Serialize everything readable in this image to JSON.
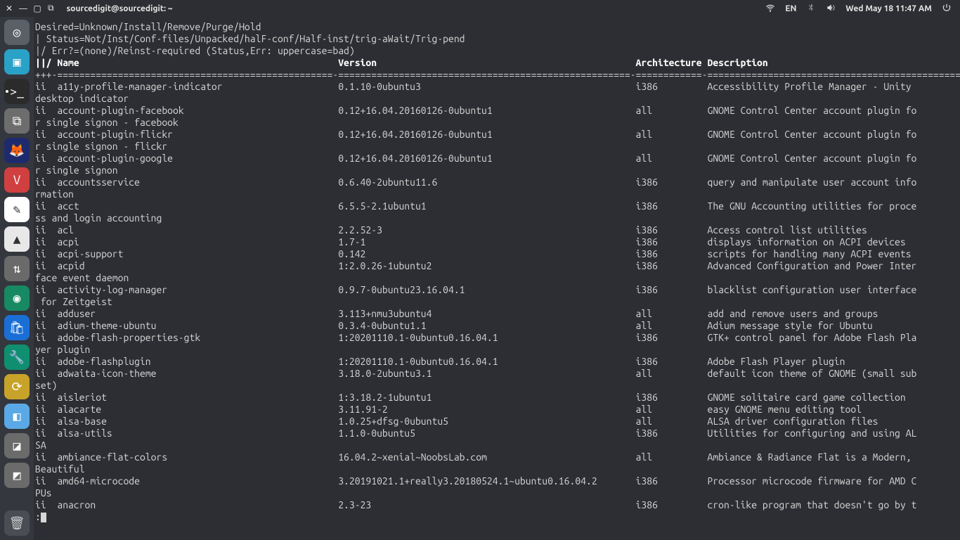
{
  "topbar": {
    "title": "sourcedigit@sourcedigit: ~",
    "lang": "EN",
    "clock": "Wed May 18 11:47 AM"
  },
  "dock": {
    "items": [
      {
        "name": "ubuntu-logo-icon",
        "bg": "#5b5f68",
        "glyph": "◎"
      },
      {
        "name": "files-icon",
        "bg": "#2aa1c7",
        "glyph": "▣"
      },
      {
        "name": "terminal-icon",
        "bg": "#2b2b2b",
        "glyph": ">_"
      },
      {
        "name": "archive-icon",
        "bg": "#6d6d6d",
        "glyph": "⧉"
      },
      {
        "name": "firefox-icon",
        "bg": "#1e2a6e",
        "glyph": "🦊"
      },
      {
        "name": "vivaldi-icon",
        "bg": "#d04040",
        "glyph": "V"
      },
      {
        "name": "text-editor-icon",
        "bg": "#ffffff",
        "glyph": "✎"
      },
      {
        "name": "vlc-icon",
        "bg": "#e8e8e8",
        "glyph": "▲"
      },
      {
        "name": "transmission-icon",
        "bg": "#6a6a6a",
        "glyph": "⇅"
      },
      {
        "name": "screenshot-icon",
        "bg": "#178a63",
        "glyph": "◉"
      },
      {
        "name": "software-icon",
        "bg": "#1a6fd6",
        "glyph": "🛍"
      },
      {
        "name": "settings-icon",
        "bg": "#0f8f6f",
        "glyph": "🔧"
      },
      {
        "name": "sync-icon",
        "bg": "#c8a32a",
        "glyph": "⟳"
      },
      {
        "name": "app-icon-1",
        "bg": "#5aa9e6",
        "glyph": "◧"
      },
      {
        "name": "app-icon-2",
        "bg": "#6b6b6b",
        "glyph": "◪"
      },
      {
        "name": "app-icon-3",
        "bg": "#6b6b6b",
        "glyph": "◩"
      }
    ],
    "trash": {
      "name": "trash-icon",
      "bg": "#4a4d54",
      "glyph": "🗑"
    }
  },
  "term": {
    "header": [
      "Desired=Unknown/Install/Remove/Purge/Hold",
      "| Status=Not/Inst/Conf-files/Unpacked/halF-conf/Half-inst/trig-aWait/Trig-pend",
      "|/ Err?=(none)/Reinst-required (Status,Err: uppercase=bad)"
    ],
    "colhdr": {
      "name": "||/ Name",
      "version": "Version",
      "arch": "Architecture",
      "desc": "Description"
    },
    "sep": "+++-==================================================-=====================================================-============-===============================================",
    "rows": [
      {
        "st": "ii",
        "name": "a11y-profile-manager-indicator",
        "ver": "0.1.10-0ubuntu3",
        "arch": "i386",
        "desc": "Accessibility Profile Manager - Unity",
        "wrap": "desktop indicator"
      },
      {
        "st": "ii",
        "name": "account-plugin-facebook",
        "ver": "0.12+16.04.20160126-0ubuntu1",
        "arch": "all",
        "desc": "GNOME Control Center account plugin fo",
        "wrap": "r single signon - facebook"
      },
      {
        "st": "ii",
        "name": "account-plugin-flickr",
        "ver": "0.12+16.04.20160126-0ubuntu1",
        "arch": "all",
        "desc": "GNOME Control Center account plugin fo",
        "wrap": "r single signon - flickr"
      },
      {
        "st": "ii",
        "name": "account-plugin-google",
        "ver": "0.12+16.04.20160126-0ubuntu1",
        "arch": "all",
        "desc": "GNOME Control Center account plugin fo",
        "wrap": "r single signon"
      },
      {
        "st": "ii",
        "name": "accountsservice",
        "ver": "0.6.40-2ubuntu11.6",
        "arch": "i386",
        "desc": "query and manipulate user account info",
        "wrap": "rmation"
      },
      {
        "st": "ii",
        "name": "acct",
        "ver": "6.5.5-2.1ubuntu1",
        "arch": "i386",
        "desc": "The GNU Accounting utilities for proce",
        "wrap": "ss and login accounting"
      },
      {
        "st": "ii",
        "name": "acl",
        "ver": "2.2.52-3",
        "arch": "i386",
        "desc": "Access control list utilities"
      },
      {
        "st": "ii",
        "name": "acpi",
        "ver": "1.7-1",
        "arch": "i386",
        "desc": "displays information on ACPI devices"
      },
      {
        "st": "ii",
        "name": "acpi-support",
        "ver": "0.142",
        "arch": "i386",
        "desc": "scripts for handling many ACPI events"
      },
      {
        "st": "ii",
        "name": "acpid",
        "ver": "1:2.0.26-1ubuntu2",
        "arch": "i386",
        "desc": "Advanced Configuration and Power Inter",
        "wrap": "face event daemon"
      },
      {
        "st": "ii",
        "name": "activity-log-manager",
        "ver": "0.9.7-0ubuntu23.16.04.1",
        "arch": "i386",
        "desc": "blacklist configuration user interface",
        "wrap": " for Zeitgeist"
      },
      {
        "st": "ii",
        "name": "adduser",
        "ver": "3.113+nmu3ubuntu4",
        "arch": "all",
        "desc": "add and remove users and groups"
      },
      {
        "st": "ii",
        "name": "adium-theme-ubuntu",
        "ver": "0.3.4-0ubuntu1.1",
        "arch": "all",
        "desc": "Adium message style for Ubuntu"
      },
      {
        "st": "ii",
        "name": "adobe-flash-properties-gtk",
        "ver": "1:20201110.1-0ubuntu0.16.04.1",
        "arch": "i386",
        "desc": "GTK+ control panel for Adobe Flash Pla",
        "wrap": "yer plugin"
      },
      {
        "st": "ii",
        "name": "adobe-flashplugin",
        "ver": "1:20201110.1-0ubuntu0.16.04.1",
        "arch": "i386",
        "desc": "Adobe Flash Player plugin"
      },
      {
        "st": "ii",
        "name": "adwaita-icon-theme",
        "ver": "3.18.0-2ubuntu3.1",
        "arch": "all",
        "desc": "default icon theme of GNOME (small sub",
        "wrap": "set)"
      },
      {
        "st": "ii",
        "name": "aisleriot",
        "ver": "1:3.18.2-1ubuntu1",
        "arch": "i386",
        "desc": "GNOME solitaire card game collection"
      },
      {
        "st": "ii",
        "name": "alacarte",
        "ver": "3.11.91-2",
        "arch": "all",
        "desc": "easy GNOME menu editing tool"
      },
      {
        "st": "ii",
        "name": "alsa-base",
        "ver": "1.0.25+dfsg-0ubuntu5",
        "arch": "all",
        "desc": "ALSA driver configuration files"
      },
      {
        "st": "ii",
        "name": "alsa-utils",
        "ver": "1.1.0-0ubuntu5",
        "arch": "i386",
        "desc": "Utilities for configuring and using AL",
        "wrap": "SA"
      },
      {
        "st": "ii",
        "name": "ambiance-flat-colors",
        "ver": "16.04.2~xenial~NoobsLab.com",
        "arch": "all",
        "desc": "Ambiance & Radiance Flat is a Modern, ",
        "wrap": "Beautiful"
      },
      {
        "st": "ii",
        "name": "amd64-microcode",
        "ver": "3.20191021.1+really3.20180524.1~ubuntu0.16.04.2",
        "arch": "i386",
        "desc": "Processor microcode firmware for AMD C",
        "wrap": "PUs"
      },
      {
        "st": "ii",
        "name": "anacron",
        "ver": "2.3-23",
        "arch": "i386",
        "desc": "cron-like program that doesn't go by t"
      }
    ],
    "prompt": ":"
  }
}
